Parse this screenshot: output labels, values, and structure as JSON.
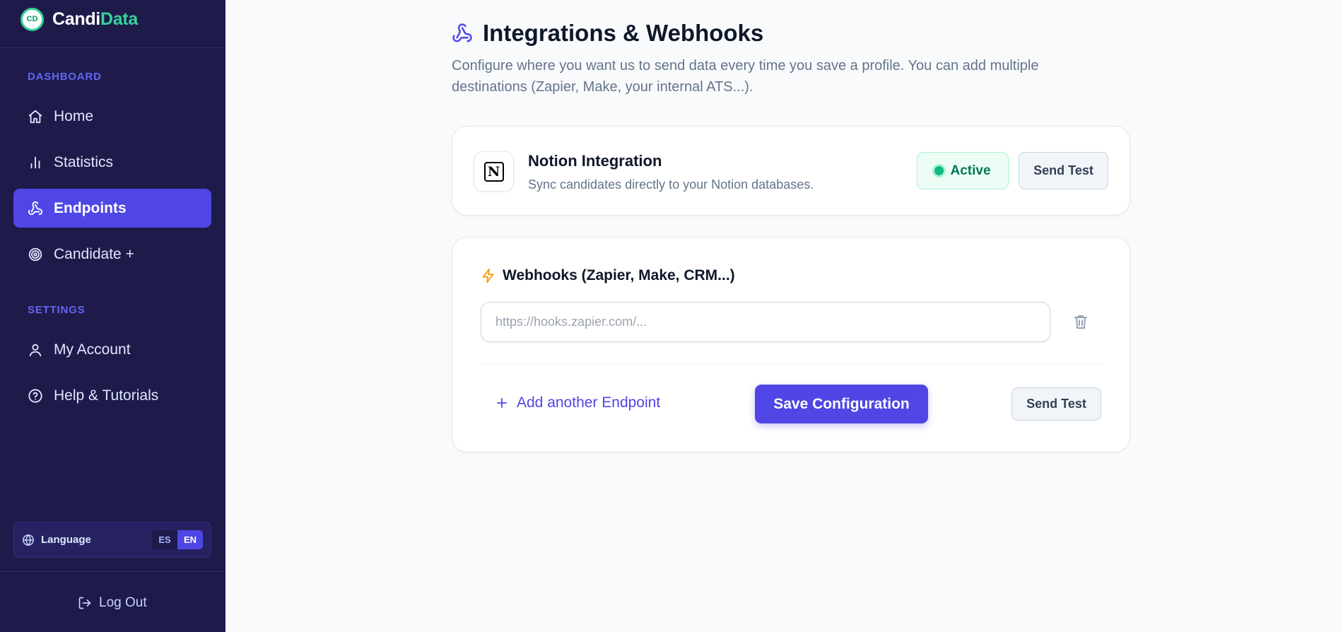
{
  "brand": {
    "logo_text": "CD",
    "name_part1": "Candi",
    "name_part2": "Data"
  },
  "sidebar": {
    "sections": [
      {
        "label": "DASHBOARD"
      },
      {
        "label": "SETTINGS"
      }
    ],
    "items": [
      {
        "label": "Home",
        "icon": "home-icon"
      },
      {
        "label": "Statistics",
        "icon": "bar-chart-icon"
      },
      {
        "label": "Endpoints",
        "icon": "webhook-icon",
        "active": true
      },
      {
        "label": "Candidate +",
        "icon": "target-icon"
      },
      {
        "label": "My Account",
        "icon": "user-icon"
      },
      {
        "label": "Help & Tutorials",
        "icon": "help-circle-icon"
      }
    ],
    "language": {
      "label": "Language",
      "options": [
        "ES",
        "EN"
      ],
      "selected": "EN"
    },
    "logout_label": "Log Out"
  },
  "page": {
    "title": "Integrations & Webhooks",
    "description": "Configure where you want us to send data every time you save a profile. You can add multiple destinations (Zapier, Make, your internal ATS...)."
  },
  "notion": {
    "logo_text": "N",
    "title": "Notion Integration",
    "subtitle": "Sync candidates directly to your Notion databases.",
    "status": "Active",
    "test_label": "Send Test"
  },
  "webhooks": {
    "title": "Webhooks (Zapier, Make, CRM...)",
    "input_value": "",
    "input_placeholder": "https://hooks.zapier.com/...",
    "add_label": "Add another Endpoint",
    "save_label": "Save Configuration",
    "test_label": "Send Test"
  },
  "colors": {
    "sidebar_bg": "#1e1b4b",
    "accent": "#4f46e5",
    "brand_accent": "#34d399",
    "success": "#10b981",
    "warning": "#f59e0b"
  }
}
